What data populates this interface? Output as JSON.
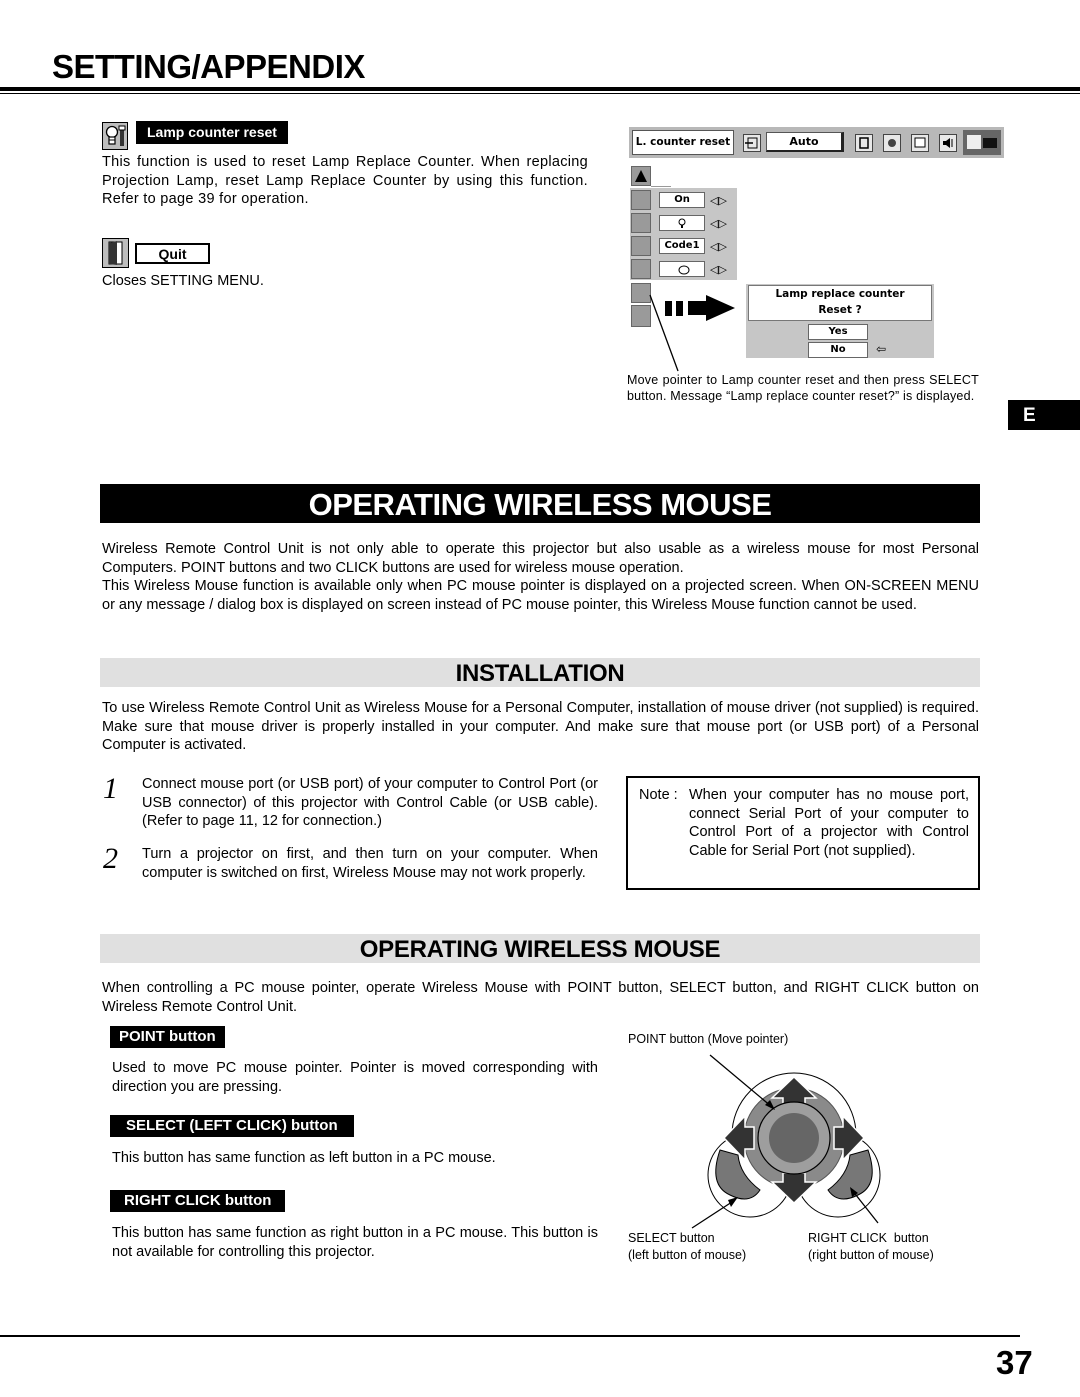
{
  "header": {
    "title": "SETTING/APPENDIX"
  },
  "setting_items": {
    "lamp_counter_reset": {
      "icon": "lamp-wrench-icon",
      "label": "Lamp counter reset",
      "description": "This function is used to reset Lamp Replace Counter.  When replacing Projection Lamp, reset Lamp Replace Counter by using this function.  Refer to page 39 for operation."
    },
    "quit": {
      "icon": "door-exit-icon",
      "label": "Quit",
      "description": "Closes SETTING MENU."
    }
  },
  "osd_figure": {
    "menu_bar": {
      "current_item": "L. counter reset",
      "input_value": "Auto",
      "icons": [
        "input-icon",
        "screen-icon",
        "image-adjust-icon",
        "pc-adjust-icon",
        "sound-icon",
        "setting-icon"
      ]
    },
    "side_menu": {
      "items": [
        {
          "icon": "up-arrow-icon",
          "value": ""
        },
        {
          "icon": "power-management-icon",
          "value": "On"
        },
        {
          "icon": "lamp-mode-icon",
          "value": "lamp-glyph"
        },
        {
          "icon": "remote-control-icon",
          "value": "Code1"
        },
        {
          "icon": "mouse-port-icon",
          "value": "mouse-glyph"
        },
        {
          "icon": "lamp-counter-reset-icon",
          "value": ""
        },
        {
          "icon": "quit-icon",
          "value": ""
        }
      ]
    },
    "dialog": {
      "line1": "Lamp replace counter",
      "line2": "Reset ?",
      "yes": "Yes",
      "no": "No"
    },
    "caption": "Move pointer to Lamp counter reset and then press SELECT button.  Message “Lamp replace counter reset?” is displayed."
  },
  "language_tab": "E",
  "main_section": {
    "title": "OPERATING WIRELESS MOUSE",
    "intro_p1": "Wireless Remote Control Unit is not only able to operate this projector but also usable as a wireless mouse for most Personal Computers.  POINT buttons and two CLICK buttons are used for wireless mouse operation.",
    "intro_p2": "This Wireless Mouse function is available only when PC mouse pointer is displayed on a projected screen.  When ON-SCREEN MENU or any message / dialog box is displayed on screen instead of PC mouse pointer, this Wireless Mouse function cannot be used."
  },
  "installation": {
    "title": "INSTALLATION",
    "text": "To use Wireless Remote Control Unit as Wireless Mouse for a Personal Computer, installation of mouse driver (not supplied) is required.  Make sure that mouse driver is properly installed in your computer.  And make sure that mouse port (or USB port) of a Personal Computer is activated.",
    "steps": [
      {
        "num": "1",
        "text": "Connect mouse port (or USB port) of your computer to Control Port (or USB connector) of this projector with Control Cable (or USB cable). (Refer to page 11, 12 for connection.)"
      },
      {
        "num": "2",
        "text": "Turn a projector on first, and then turn on your computer.  When computer is switched on first, Wireless Mouse may not work properly."
      }
    ],
    "note_label": "Note :",
    "note_text": "When your computer has no mouse port, connect Serial Port of your computer to Control Port of a projector with Control Cable for Serial Port (not supplied)."
  },
  "operating": {
    "title": "OPERATING WIRELESS MOUSE",
    "text": "When controlling a PC mouse pointer, operate Wireless Mouse with POINT button, SELECT button, and RIGHT CLICK button on Wireless Remote Control Unit.",
    "buttons": [
      {
        "label": "POINT button",
        "text": "Used to move PC mouse pointer.  Pointer is moved corresponding with direction you are pressing."
      },
      {
        "label": "SELECT (LEFT CLICK) button",
        "text": "This button has same function as left button in a PC mouse."
      },
      {
        "label": "RIGHT CLICK button",
        "text": "This button has same function as right button in a PC mouse. This button is not available for controlling this projector."
      }
    ],
    "figure": {
      "point_caption": "POINT button (Move pointer)",
      "select_caption_1": "SELECT button",
      "select_caption_2": "(left button of mouse)",
      "right_caption_1": "RIGHT CLICK  button",
      "right_caption_2": "(right button of mouse)"
    }
  },
  "footer": {
    "page_number": "37"
  }
}
